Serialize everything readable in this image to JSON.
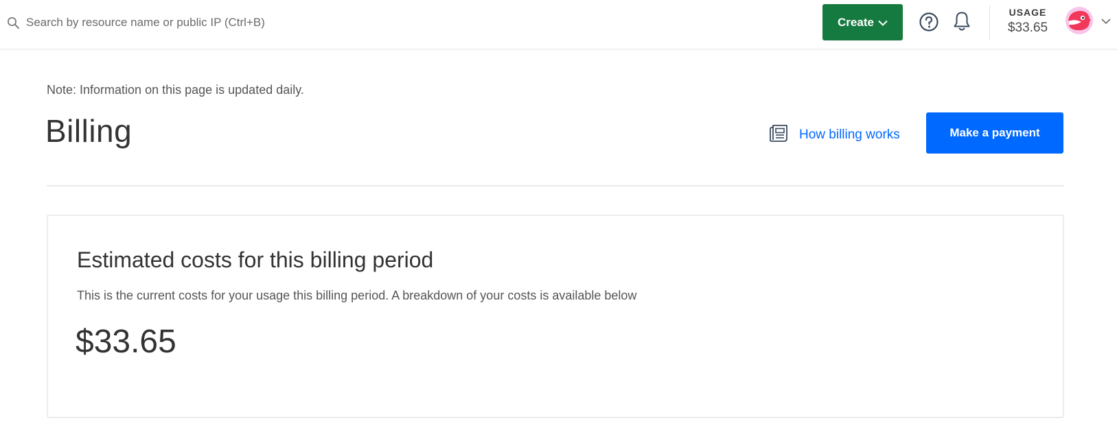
{
  "search": {
    "placeholder": "Search by resource name or public IP (Ctrl+B)",
    "icon": "search-icon"
  },
  "topbar": {
    "create_label": "Create",
    "create_color": "#157a3f",
    "help_icon": "question-circle-icon",
    "bell_icon": "bell-icon",
    "usage_label": "USAGE",
    "usage_value": "$33.65"
  },
  "header": {
    "note": "Note: Information on this page is updated daily.",
    "title": "Billing",
    "how_billing_works": "How billing works",
    "make_payment": "Make a payment",
    "accent_color": "#0069ff"
  },
  "estimate": {
    "title": "Estimated costs for this billing period",
    "description": "This is the current costs for your usage this billing period. A breakdown of your costs is available below",
    "amount": "$33.65"
  }
}
